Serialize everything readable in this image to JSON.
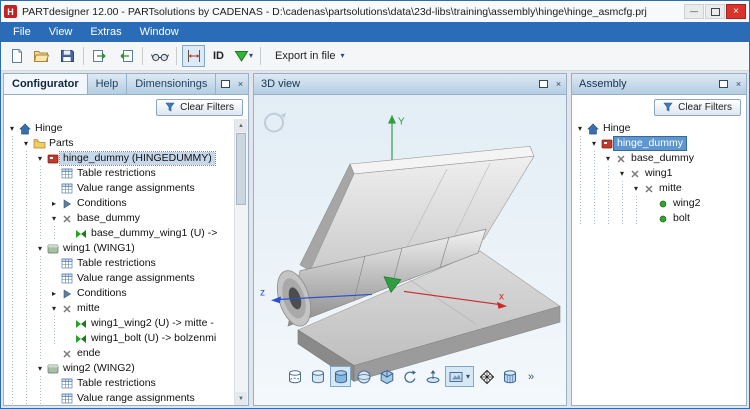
{
  "window": {
    "title": "PARTdesigner 12.00 - PARTsolutions by CADENAS - D:\\cadenas\\partsolutions\\data\\23d-libs\\training\\assembly\\hinge\\hinge_asmcfg.prj",
    "logo_text": "H"
  },
  "icons": {
    "minimize": "—",
    "close": "×",
    "caret": "▾",
    "overflow": "»",
    "expand_open": "▾",
    "expand_closed": "▸",
    "scroll_up": "▲",
    "scroll_down": "▼"
  },
  "menu": {
    "items": [
      "File",
      "View",
      "Extras",
      "Window"
    ]
  },
  "toolbar": {
    "items": [
      {
        "type": "icon",
        "name": "new-file-icon"
      },
      {
        "type": "icon",
        "name": "open-file-icon"
      },
      {
        "type": "icon",
        "name": "save-file-icon"
      },
      {
        "type": "sep"
      },
      {
        "type": "icon",
        "name": "import-part-icon"
      },
      {
        "type": "icon",
        "name": "export-part-icon"
      },
      {
        "type": "sep"
      },
      {
        "type": "icon",
        "name": "glasses-icon"
      },
      {
        "type": "sep"
      },
      {
        "type": "icon",
        "name": "dimensions-icon",
        "pressed": true
      },
      {
        "type": "texticon",
        "name": "id-button",
        "label": "ID"
      },
      {
        "type": "icon",
        "name": "part-selection-icon",
        "caret": true
      },
      {
        "type": "sep"
      },
      {
        "type": "button",
        "name": "export-in-file-button",
        "label": "Export in file",
        "caret": true
      }
    ]
  },
  "configurator": {
    "tabs": [
      {
        "label": "Configurator",
        "active": true
      },
      {
        "label": "Help"
      },
      {
        "label": "Dimensionings"
      }
    ],
    "clear_filters_label": "Clear Filters",
    "tree": [
      {
        "label": "Hinge",
        "depth": 0,
        "icon": "home",
        "exp": "open"
      },
      {
        "label": "Parts",
        "depth": 1,
        "icon": "folder",
        "exp": "open"
      },
      {
        "label": "hinge_dummy (HINGEDUMMY)",
        "depth": 2,
        "icon": "part-red",
        "exp": "open",
        "selected": true
      },
      {
        "label": "Table restrictions",
        "depth": 3,
        "icon": "table"
      },
      {
        "label": "Value range assignments",
        "depth": 3,
        "icon": "table"
      },
      {
        "label": "Conditions",
        "depth": 3,
        "icon": "cond",
        "exp": "closed"
      },
      {
        "label": "base_dummy",
        "depth": 3,
        "icon": "x",
        "exp": "open"
      },
      {
        "label": "base_dummy_wing1 (U) ->",
        "depth": 4,
        "icon": "link"
      },
      {
        "label": "wing1 (WING1)",
        "depth": 2,
        "icon": "part",
        "exp": "open"
      },
      {
        "label": "Table restrictions",
        "depth": 3,
        "icon": "table"
      },
      {
        "label": "Value range assignments",
        "depth": 3,
        "icon": "table"
      },
      {
        "label": "Conditions",
        "depth": 3,
        "icon": "cond",
        "exp": "closed"
      },
      {
        "label": "mitte",
        "depth": 3,
        "icon": "x",
        "exp": "open"
      },
      {
        "label": "wing1_wing2 (U) -> mitte -",
        "depth": 4,
        "icon": "link"
      },
      {
        "label": "wing1_bolt (U) -> bolzenmi",
        "depth": 4,
        "icon": "link"
      },
      {
        "label": "ende",
        "depth": 3,
        "icon": "x"
      },
      {
        "label": "wing2 (WING2)",
        "depth": 2,
        "icon": "part",
        "exp": "open"
      },
      {
        "label": "Table restrictions",
        "depth": 3,
        "icon": "table"
      },
      {
        "label": "Value range assignments",
        "depth": 3,
        "icon": "table"
      }
    ]
  },
  "viewport": {
    "title": "3D view",
    "axis_labels": {
      "x": "x",
      "y": "Y",
      "z": "z"
    },
    "icons": [
      {
        "name": "wireframe-icon"
      },
      {
        "name": "flat-shaded-icon"
      },
      {
        "name": "shaded-icon",
        "pressed": true
      },
      {
        "name": "sphere-view-icon"
      },
      {
        "name": "cube-view-icon"
      },
      {
        "name": "rotate-view-icon"
      },
      {
        "name": "turntable-icon"
      },
      {
        "name": "view-preset-icon",
        "pressed": true,
        "caret": true
      },
      {
        "name": "mesh-quality-icon"
      },
      {
        "name": "cylinder-quality-icon"
      },
      {
        "name": "overflow-button",
        "overflow": true
      }
    ]
  },
  "assembly": {
    "title": "Assembly",
    "clear_filters_label": "Clear Filters",
    "tree": [
      {
        "label": "Hinge",
        "depth": 0,
        "icon": "home",
        "exp": "open"
      },
      {
        "label": "hinge_dummy",
        "depth": 1,
        "icon": "part-red",
        "exp": "open",
        "selected": true
      },
      {
        "label": "base_dummy",
        "depth": 2,
        "icon": "x",
        "exp": "open"
      },
      {
        "label": "wing1",
        "depth": 3,
        "icon": "x",
        "exp": "open"
      },
      {
        "label": "mitte",
        "depth": 4,
        "icon": "x",
        "exp": "open"
      },
      {
        "label": "wing2",
        "depth": 5,
        "icon": "dot"
      },
      {
        "label": "bolt",
        "depth": 5,
        "icon": "dot"
      }
    ]
  }
}
